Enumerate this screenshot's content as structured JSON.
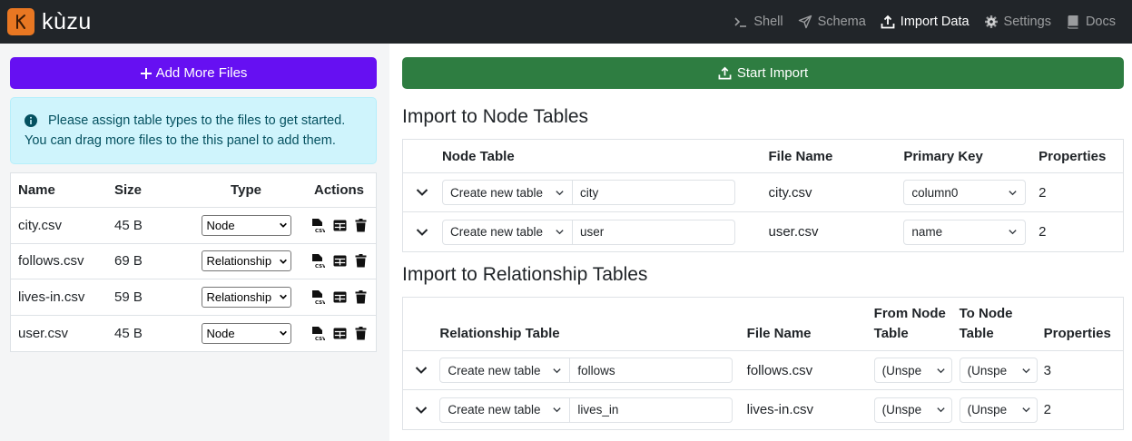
{
  "brand": {
    "name": "kùzu",
    "logo_letter": "K",
    "logo_color": "#e87722"
  },
  "nav": [
    {
      "label": "Shell",
      "icon": "terminal-icon",
      "active": false
    },
    {
      "label": "Schema",
      "icon": "send-icon",
      "active": false
    },
    {
      "label": "Import Data",
      "icon": "upload-icon",
      "active": true
    },
    {
      "label": "Settings",
      "icon": "gear-icon",
      "active": false
    },
    {
      "label": "Docs",
      "icon": "book-icon",
      "active": false
    }
  ],
  "left": {
    "add_button": "Add More Files",
    "alert_line1": "Please assign table types to the files to get started.",
    "alert_line2": "You can drag more files to the this panel to add them.",
    "columns": {
      "name": "Name",
      "size": "Size",
      "type": "Type",
      "actions": "Actions"
    },
    "files": [
      {
        "name": "city.csv",
        "size": "45 B",
        "type": "Node"
      },
      {
        "name": "follows.csv",
        "size": "69 B",
        "type": "Relationship"
      },
      {
        "name": "lives-in.csv",
        "size": "59 B",
        "type": "Relationship"
      },
      {
        "name": "user.csv",
        "size": "45 B",
        "type": "Node"
      }
    ]
  },
  "right": {
    "start_button": "Start Import",
    "node_section": {
      "title": "Import to Node Tables",
      "columns": {
        "table": "Node Table",
        "file": "File Name",
        "pk": "Primary Key",
        "props": "Properties"
      },
      "rows": [
        {
          "mode": "Create new table",
          "table_name": "city",
          "file": "city.csv",
          "pk": "column0",
          "props": "2"
        },
        {
          "mode": "Create new table",
          "table_name": "user",
          "file": "user.csv",
          "pk": "name",
          "props": "2"
        }
      ]
    },
    "rel_section": {
      "title": "Import to Relationship Tables",
      "columns": {
        "table": "Relationship Table",
        "file": "File Name",
        "from_1": "From Node",
        "from_2": "Table",
        "to_1": "To Node",
        "to_2": "Table",
        "props": "Properties"
      },
      "rows": [
        {
          "mode": "Create new table",
          "table_name": "follows",
          "file": "follows.csv",
          "from": "(Unspe",
          "to": "(Unspe",
          "props": "3"
        },
        {
          "mode": "Create new table",
          "table_name": "lives_in",
          "file": "lives-in.csv",
          "from": "(Unspe",
          "to": "(Unspe",
          "props": "2"
        }
      ]
    }
  }
}
